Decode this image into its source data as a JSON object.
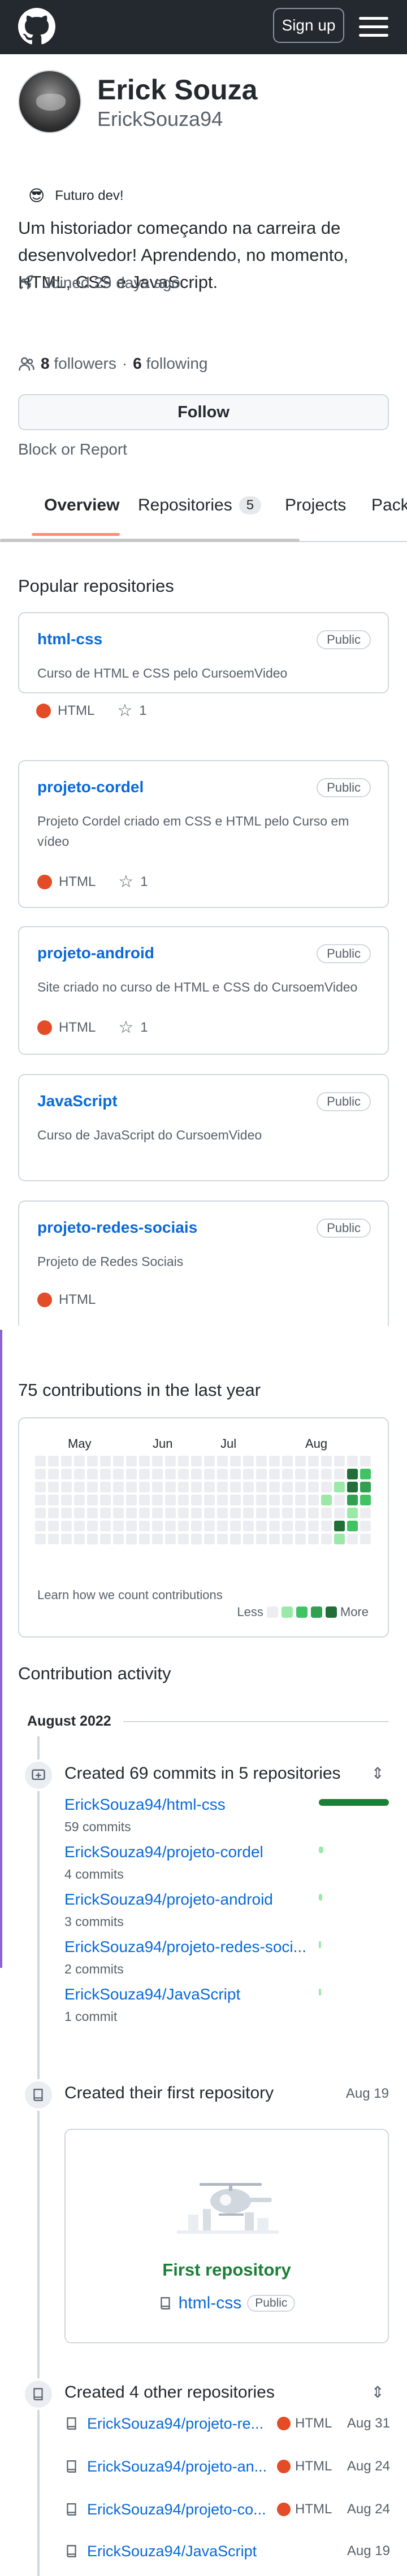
{
  "header": {
    "signup_label": "Sign up"
  },
  "profile": {
    "full_name": "Erick Souza",
    "username": "ErickSouza94",
    "status_emoji": "😎",
    "status_text": "Futuro dev!",
    "bio": "Um historiador começando na carreira de desenvolvedor! Aprendendo, no momento, HTML, CSS e JavaScript.",
    "joined": "Joined 29 days ago",
    "followers_count": "8",
    "followers_label": "followers",
    "separator": "·",
    "following_count": "6",
    "following_label": "following",
    "follow_label": "Follow",
    "block_label": "Block or Report"
  },
  "tabs": [
    {
      "label": "Overview"
    },
    {
      "label": "Repositories",
      "count": "5"
    },
    {
      "label": "Projects"
    },
    {
      "label": "Packa"
    }
  ],
  "popular": {
    "title": "Popular repositories",
    "repos": [
      {
        "name": "html-css",
        "visibility": "Public",
        "desc": "Curso de HTML e CSS pelo CursoemVideo",
        "lang": "HTML",
        "stars": "1"
      },
      {
        "name": "projeto-cordel",
        "visibility": "Public",
        "desc": "Projeto Cordel criado em CSS e HTML pelo Curso em vídeo",
        "lang": "HTML",
        "stars": "1"
      },
      {
        "name": "projeto-android",
        "visibility": "Public",
        "desc": "Site criado no curso de HTML e CSS do CursoemVideo",
        "lang": "HTML",
        "stars": "1"
      },
      {
        "name": "JavaScript",
        "visibility": "Public",
        "desc": "Curso de JavaScript do CursoemVideo"
      },
      {
        "name": "projeto-redes-sociais",
        "visibility": "Public",
        "desc": "Projeto de Redes Sociais",
        "lang": "HTML"
      }
    ]
  },
  "contributions": {
    "title": "75 contributions in the last year",
    "months": [
      "May",
      "Jun",
      "Jul",
      "Aug"
    ],
    "learn": "Learn how we count contributions",
    "legend_less": "Less",
    "legend_more": "More",
    "colors": [
      "#ebedf0",
      "#9be9a8",
      "#40c463",
      "#30a14e",
      "#216e39"
    ],
    "active_cells": [
      {
        "week": 22,
        "day": 3,
        "level": 1
      },
      {
        "week": 23,
        "day": 2,
        "level": 1
      },
      {
        "week": 24,
        "day": 1,
        "level": 4
      },
      {
        "week": 24,
        "day": 2,
        "level": 4
      },
      {
        "week": 24,
        "day": 3,
        "level": 3
      },
      {
        "week": 24,
        "day": 5,
        "level": 2
      },
      {
        "week": 25,
        "day": 1,
        "level": 2
      },
      {
        "week": 25,
        "day": 2,
        "level": 3
      },
      {
        "week": 25,
        "day": 3,
        "level": 2
      },
      {
        "week": 23,
        "day": 5,
        "level": 4
      },
      {
        "week": 23,
        "day": 6,
        "level": 1
      },
      {
        "week": 24,
        "day": 4,
        "level": 1
      }
    ]
  },
  "activity": {
    "title": "Contribution activity",
    "month": "August 2022",
    "commits_head": "Created 69 commits in 5 repositories",
    "commits": [
      {
        "repo": "ErickSouza94/html-css",
        "count": "59 commits",
        "share": 1.0
      },
      {
        "repo": "ErickSouza94/projeto-cordel",
        "count": "4 commits",
        "share": 0.068
      },
      {
        "repo": "ErickSouza94/projeto-android",
        "count": "3 commits",
        "share": 0.05
      },
      {
        "repo": "ErickSouza94/projeto-redes-soci...",
        "count": "2 commits",
        "share": 0.034
      },
      {
        "repo": "ErickSouza94/JavaScript",
        "count": "1 commit",
        "share": 0.017
      }
    ],
    "first_repo_head": "Created their first repository",
    "first_repo_date": "Aug 19",
    "first_repo_title": "First repository",
    "first_repo_name": "html-css",
    "first_repo_visibility": "Public",
    "other_head": "Created 4 other repositories",
    "other_repos": [
      {
        "name": "ErickSouza94/projeto-re...",
        "lang": "HTML",
        "date": "Aug 31"
      },
      {
        "name": "ErickSouza94/projeto-an...",
        "lang": "HTML",
        "date": "Aug 24"
      },
      {
        "name": "ErickSouza94/projeto-co...",
        "lang": "HTML",
        "date": "Aug 24"
      },
      {
        "name": "ErickSouza94/JavaScript",
        "lang": "",
        "date": "Aug 19"
      }
    ]
  }
}
